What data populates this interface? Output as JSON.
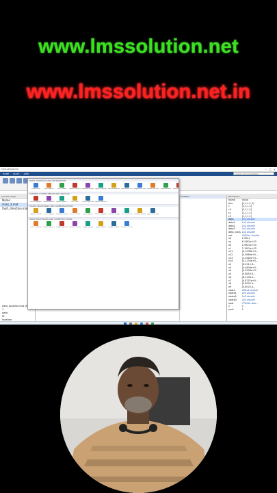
{
  "banners": {
    "top": "www.lmssolution.net",
    "bottom": "www.lmssolution.net.in"
  },
  "window": {
    "title": "MATLAB R2023b",
    "tabs": [
      "HOME",
      "PLOTS",
      "APPS"
    ],
    "search_placeholder": "Search Documentation"
  },
  "files": {
    "header": "Current Folder",
    "items": [
      "Name",
      "class_3.mat",
      "fault_direction.mat"
    ]
  },
  "workspace_list": [
    "data_location.mat (MAT-file)",
    "1",
    "data",
    "fit",
    "location",
    "autoopt",
    "1"
  ],
  "apps": {
    "sections": [
      {
        "title": "MATH, STATISTICS AND OPTIMIZATION",
        "apps": [
          "Curve Fitter",
          "Optimization",
          "PDE Modeler",
          "System Identification",
          "Wavelet Analyzer",
          "Signal Analyzer",
          "Neural Network",
          "Distribution Fitter",
          "Regression Learner",
          "Neural Net Clustering",
          "Deep Network",
          "Experiment Manager"
        ]
      },
      {
        "title": "CONTROL SYSTEM DESIGN AND ANALYSIS",
        "apps": [
          "Control System Designer",
          "Model Reducer",
          "Linear System Analyzer",
          "PID Tuner",
          "Fuzzy Logic Designer",
          "System Identification"
        ]
      },
      {
        "title": "SIGNAL PROCESSING AND COMMUNICATIONS",
        "apps": [
          "Signal Analyzer",
          "Filter Designer",
          "Wavelet Analyzer",
          "Bit Error Rate",
          "Eye Diagram",
          "Radar Designer",
          "Antenna Designer",
          "LTE Waveform",
          "Wireless Waveform",
          "Spectrum Analyzer"
        ]
      },
      {
        "title": "IMAGE PROCESSING AND COMPUTER VISION",
        "apps": [
          "Color Thresholder",
          "Image Region Analyzer",
          "Image Segmenter",
          "Camera Calibrator",
          "Image Labeler",
          "Video Labeler",
          "Image Browser",
          "Ground Truth Labeler"
        ]
      }
    ]
  },
  "editor_tab": "Untitled",
  "workspace": {
    "header": "Workspace",
    "columns": [
      "Name",
      "Value"
    ],
    "rows": [
      {
        "name": "ans",
        "value": "[1,1,1,1,1]"
      },
      {
        "name": "c",
        "value": "[1,1,1,1]"
      },
      {
        "name": "c0",
        "value": "[1,1,1,1]"
      },
      {
        "name": "c1",
        "value": "[1,1,1,1]"
      },
      {
        "name": "c2",
        "value": "[1,1,1,1]"
      },
      {
        "name": "data",
        "value": "1x2 double"
      },
      {
        "name": "data1",
        "value": "1x2 double"
      },
      {
        "name": "data2",
        "value": "1x2 double"
      },
      {
        "name": "data3",
        "value": "1x2 double"
      },
      {
        "name": "data_class",
        "value": "1x2 double"
      },
      {
        "name": "out",
        "value": "1000x1 double"
      },
      {
        "name": "v0",
        "value": "2.5921"
      },
      {
        "name": "xx",
        "value": "6.1582e+03"
      },
      {
        "name": "x0",
        "value": "2.9945e+03"
      },
      {
        "name": "x1",
        "value": "2.1502e+03"
      },
      {
        "name": "x11",
        "value": "[4.1238e+0..."
      },
      {
        "name": "x12",
        "value": "[2.0869e+0..."
      },
      {
        "name": "x13",
        "value": "[1.0562e+0..."
      },
      {
        "name": "x14",
        "value": "[4.1253e+0..."
      },
      {
        "name": "x2",
        "value": "[6.2212.6..."
      },
      {
        "name": "x3",
        "value": "[4.4809e+0..."
      },
      {
        "name": "x4",
        "value": "[4.4506e+0..."
      },
      {
        "name": "x5",
        "value": "[5.8653.6..."
      },
      {
        "name": "x6",
        "value": "[8.2148.4..."
      },
      {
        "name": "x7",
        "value": "[4.8757e+0..."
      },
      {
        "name": "x8",
        "value": "[4.6502.4..."
      },
      {
        "name": "x9",
        "value": "[5.8023.4..."
      },
      {
        "name": "xdata",
        "value": "500x4 double"
      },
      {
        "name": "xdata1",
        "value": "2x5 double"
      },
      {
        "name": "xdata2",
        "value": "2x5 double"
      },
      {
        "name": "xdata3",
        "value": "2x5 double"
      },
      {
        "name": "xout",
        "value": "7750x4 dou..."
      },
      {
        "name": "y",
        "value": "1"
      },
      {
        "name": "yout",
        "value": "1"
      }
    ]
  },
  "colors": {
    "banner_top": "#39e31c",
    "banner_bottom": "#ff2020",
    "ribbon": "#1f4e8c"
  }
}
